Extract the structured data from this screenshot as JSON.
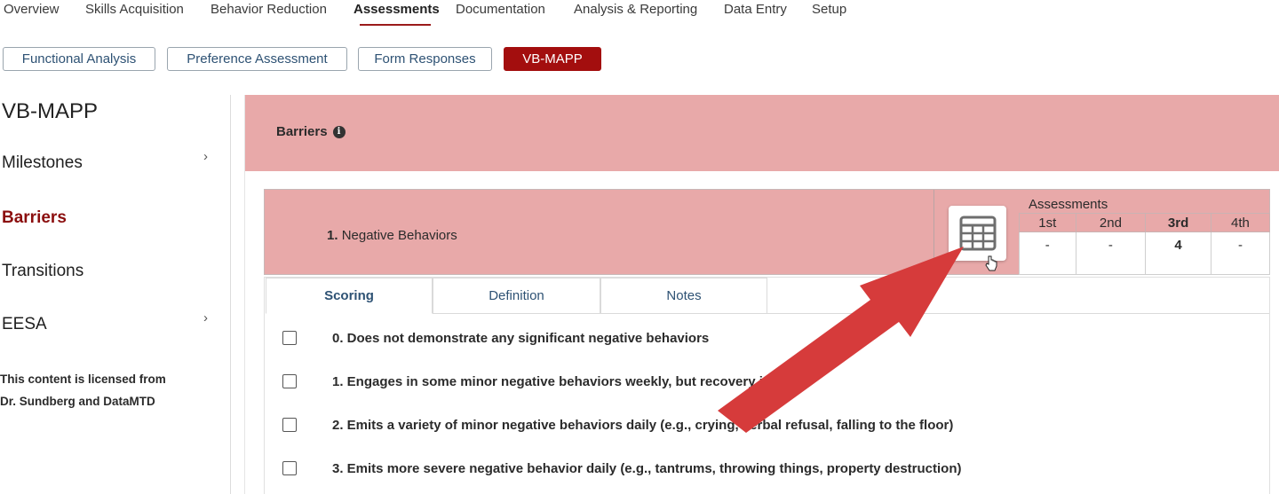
{
  "topnav": {
    "items": [
      "Overview",
      "Skills Acquisition",
      "Behavior Reduction",
      "Assessments",
      "Documentation",
      "Analysis & Reporting",
      "Data Entry",
      "Setup"
    ],
    "active": "Assessments"
  },
  "subnav": {
    "buttons": [
      "Functional Analysis",
      "Preference Assessment",
      "Form Responses",
      "VB-MAPP"
    ],
    "active": "VB-MAPP"
  },
  "sidebar": {
    "title": "VB-MAPP",
    "items": [
      "Milestones",
      "Barriers",
      "Transitions",
      "EESA"
    ],
    "active": "Barriers",
    "license_line1": "This content is licensed from",
    "license_line2": "Dr. Sundberg and DataMTD"
  },
  "main": {
    "section_title": "Barriers",
    "row": {
      "number": "1.",
      "title": "Negative Behaviors"
    },
    "assessments": {
      "title": "Assessments",
      "columns": [
        "1st",
        "2nd",
        "3rd",
        "4th"
      ],
      "values": [
        "-",
        "-",
        "4",
        "-"
      ],
      "current": "3rd"
    },
    "tabs": [
      "Scoring",
      "Definition",
      "Notes"
    ],
    "active_tab": "Scoring",
    "options": [
      "0. Does not demonstrate any significant negative behaviors",
      "1. Engages in some minor negative behaviors weekly, but recovery is",
      "2. Emits a variety of minor negative behaviors daily (e.g., crying, verbal refusal, falling to the floor)",
      "3. Emits more severe negative behavior daily (e.g., tantrums, throwing things, property destruction)"
    ]
  },
  "colors": {
    "accent": "#a30e0e",
    "banner": "#e8a9a9",
    "arrow": "#d63b3b",
    "link": "#2e5274"
  }
}
